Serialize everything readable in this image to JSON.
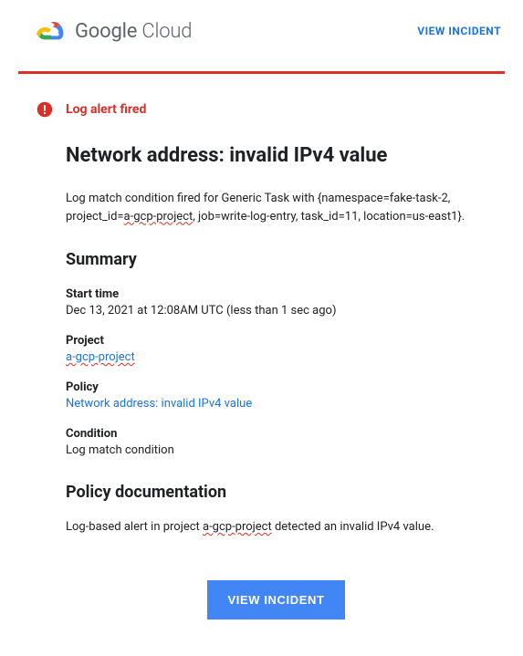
{
  "header": {
    "brand_google": "Google",
    "brand_cloud": " Cloud",
    "view_incident_label": "VIEW INCIDENT"
  },
  "alert": {
    "label": "Log alert fired",
    "title": "Network address: invalid IPv4 value",
    "description_prefix": "Log match condition fired for Generic Task with {namespace=fake-task-2, project_id=",
    "description_project": "a-gcp-project",
    "description_suffix": ", job=write-log-entry, task_id=11, location=us-east1}."
  },
  "summary": {
    "heading": "Summary",
    "start_time_label": "Start time",
    "start_time_value": "Dec 13, 2021 at 12:08AM UTC (less than 1 sec ago)",
    "project_label": "Project",
    "project_value": "a-gcp-project",
    "policy_label": "Policy",
    "policy_value": "Network address: invalid IPv4 value",
    "condition_label": "Condition",
    "condition_value": "Log match condition"
  },
  "policy_doc": {
    "heading": "Policy documentation",
    "text_prefix": "Log-based alert in project ",
    "text_project": "a-gcp-project",
    "text_suffix": " detected an invalid IPv4 value."
  },
  "footer": {
    "view_incident_button": "VIEW INCIDENT"
  }
}
